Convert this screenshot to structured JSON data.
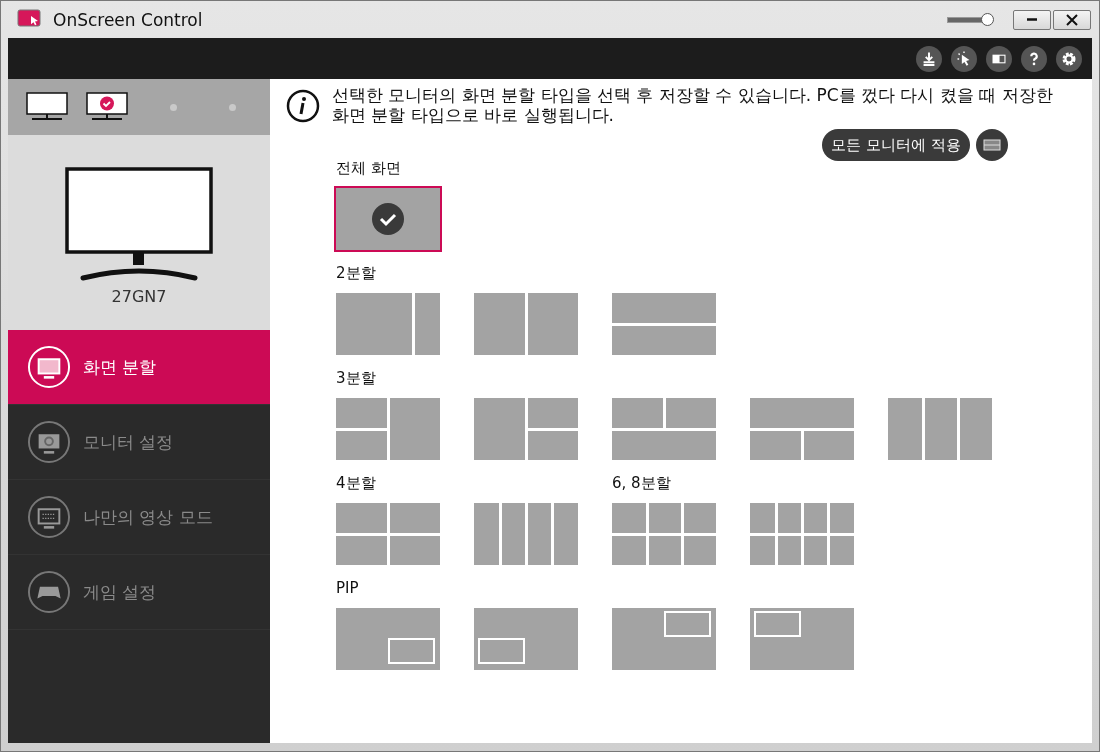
{
  "window": {
    "title": "OnScreen Control",
    "zoom_slider": {
      "level": 0.88
    }
  },
  "sidebar": {
    "monitors": [
      {
        "selected": false
      },
      {
        "selected": true
      }
    ],
    "model": "27GN7",
    "nav": [
      {
        "label": "화면 분할",
        "selected": true
      },
      {
        "label": "모니터 설정",
        "selected": false
      },
      {
        "label": "나만의 영상 모드",
        "selected": false
      },
      {
        "label": "게임 설정",
        "selected": false
      }
    ]
  },
  "info": "선택한 모니터의 화면 분할 타입을 선택 후 저장할 수 있습니다. PC를 껐다 다시 켰을 때 저장한 화면 분할 타입으로 바로 실행됩니다.",
  "apply_all_button": "모든 모니터에 적용",
  "rows": [
    {
      "groups": [
        {
          "title": "전체 화면",
          "tiles": [
            {
              "kind": "full",
              "selected": true
            }
          ]
        }
      ]
    },
    {
      "groups": [
        {
          "title": "2분할",
          "tiles": [
            {
              "kind": "wide-narrow",
              "selected": false
            },
            {
              "kind": "halves-v",
              "selected": false
            },
            {
              "kind": "halves-h",
              "selected": false
            }
          ]
        }
      ]
    },
    {
      "groups": [
        {
          "title": "3분할",
          "tiles": [
            {
              "kind": "left-stack",
              "selected": false
            },
            {
              "kind": "right-stack",
              "selected": false
            },
            {
              "kind": "top-split",
              "selected": false
            },
            {
              "kind": "bottom-split",
              "selected": false
            },
            {
              "kind": "three-cols",
              "selected": false
            }
          ]
        }
      ]
    },
    {
      "groups": [
        {
          "title": "4분할",
          "tiles": [
            {
              "kind": "quad",
              "selected": false
            },
            {
              "kind": "four-cols",
              "selected": false
            }
          ]
        },
        {
          "title": "6, 8분할",
          "tiles": [
            {
              "kind": "six",
              "selected": false
            },
            {
              "kind": "eight",
              "selected": false
            }
          ]
        }
      ]
    },
    {
      "groups": [
        {
          "title": "PIP",
          "tiles": [
            {
              "kind": "pip-br",
              "selected": false
            },
            {
              "kind": "pip-bl",
              "selected": false
            },
            {
              "kind": "pip-tr",
              "selected": false
            },
            {
              "kind": "pip-tl",
              "selected": false
            }
          ]
        }
      ]
    }
  ]
}
